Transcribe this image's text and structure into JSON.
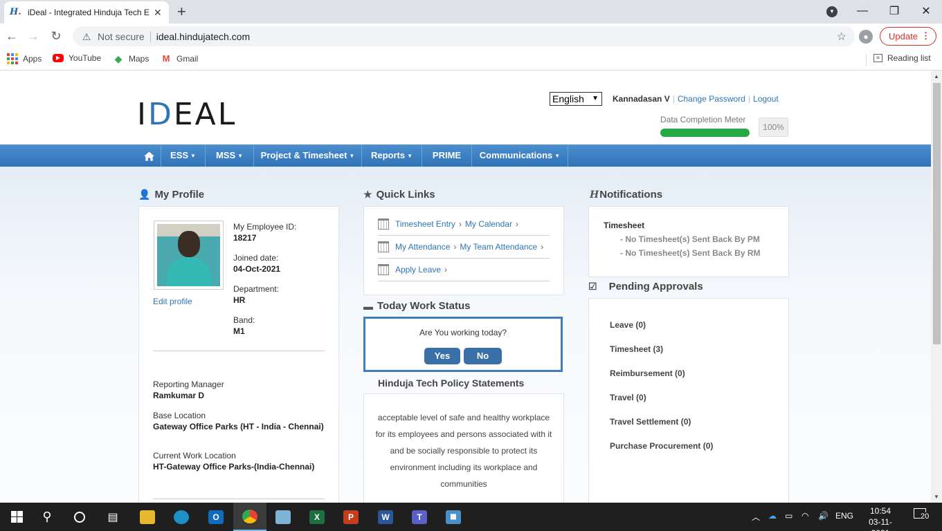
{
  "browser": {
    "tab_title": "iDeal - Integrated Hinduja Tech E",
    "security_label": "Not secure",
    "url": "ideal.hindujatech.com",
    "update_label": "Update",
    "bookmarks": [
      {
        "label": "Apps",
        "icon": "apps-grid-icon"
      },
      {
        "label": "YouTube",
        "icon": "youtube-icon"
      },
      {
        "label": "Maps",
        "icon": "maps-icon"
      },
      {
        "label": "Gmail",
        "icon": "gmail-icon"
      }
    ],
    "reading_list": "Reading list"
  },
  "header": {
    "logo": {
      "pre": "I",
      "d": "D",
      "post": "EAL"
    },
    "language": "English",
    "user_name": "Kannadasan V",
    "change_password": "Change Password",
    "logout": "Logout",
    "data_completion_label": "Data Completion Meter",
    "data_completion_value": 100,
    "data_completion_text": "100%"
  },
  "nav": {
    "items": [
      "ESS",
      "MSS",
      "Project & Timesheet",
      "Reports",
      "PRIME",
      "Communications"
    ]
  },
  "profile": {
    "title": "My Profile",
    "edit_label": "Edit profile",
    "employee_id_label": "My Employee ID:",
    "employee_id": "18217",
    "joined_label": "Joined date:",
    "joined": "04-Oct-2021",
    "department_label": "Department:",
    "department": "HR",
    "band_label": "Band:",
    "band": "M1",
    "manager_label": "Reporting Manager",
    "manager": "Ramkumar D",
    "base_label": "Base Location",
    "base": "Gateway Office Parks (HT - India - Chennai)",
    "work_label": "Current Work Location",
    "work": "HT-Gateway Office Parks-(India-Chennai)"
  },
  "quick_links": {
    "title": "Quick Links",
    "rows": [
      {
        "a": "Timesheet Entry",
        "b": "My Calendar"
      },
      {
        "a": "My Attendance",
        "b": "My Team Attendance"
      },
      {
        "a": "Apply Leave",
        "b": ""
      }
    ]
  },
  "work_status": {
    "title": "Today Work Status",
    "question": "Are You working today?",
    "yes": "Yes",
    "no": "No"
  },
  "policy": {
    "title": "Hinduja Tech Policy Statements",
    "text": "acceptable level of safe and healthy workplace for its employees and persons associated with it and be socially responsible to protect its environment including its workplace and communities"
  },
  "notifications": {
    "title": "Notifications",
    "heading": "Timesheet",
    "lines": [
      "- No Timesheet(s) Sent Back By PM",
      "- No Timesheet(s) Sent Back By RM"
    ]
  },
  "approvals": {
    "title": "Pending Approvals",
    "items": [
      "Leave (0)",
      "Timesheet (3)",
      "Reimbursement (0)",
      "Travel (0)",
      "Travel Settlement (0)",
      "Purchase Procurement (0)"
    ]
  },
  "taskbar": {
    "language": "ENG",
    "time": "10:54",
    "date": "03-11-2021",
    "notification_count": "20"
  }
}
